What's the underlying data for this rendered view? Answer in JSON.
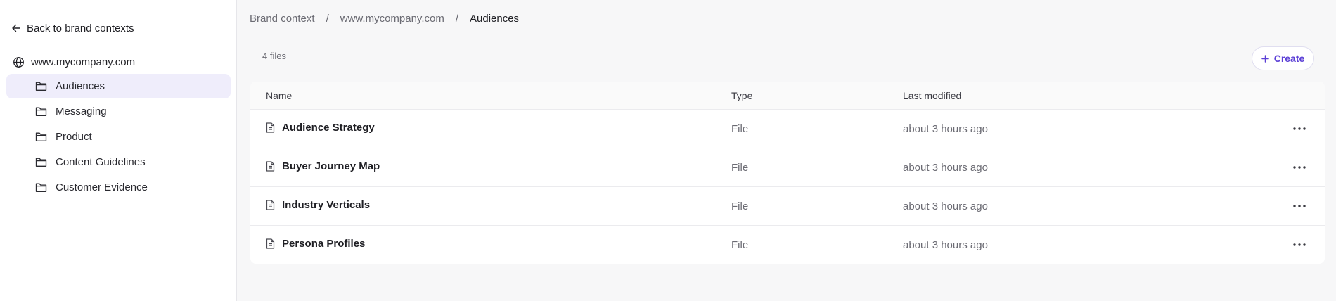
{
  "sidebar": {
    "back_label": "Back to brand contexts",
    "site": "www.mycompany.com",
    "folders": [
      {
        "label": "Audiences",
        "active": true
      },
      {
        "label": "Messaging",
        "active": false
      },
      {
        "label": "Product",
        "active": false
      },
      {
        "label": "Content Guidelines",
        "active": false
      },
      {
        "label": "Customer Evidence",
        "active": false
      }
    ]
  },
  "breadcrumb": {
    "items": [
      "Brand context",
      "www.mycompany.com",
      "Audiences"
    ],
    "separator": "/"
  },
  "toolbar": {
    "file_count": "4 files",
    "create_label": "Create"
  },
  "table": {
    "columns": [
      "Name",
      "Type",
      "Last modified"
    ],
    "rows": [
      {
        "name": "Audience Strategy",
        "type": "File",
        "modified": "about 3 hours ago"
      },
      {
        "name": "Buyer Journey Map",
        "type": "File",
        "modified": "about 3 hours ago"
      },
      {
        "name": "Industry Verticals",
        "type": "File",
        "modified": "about 3 hours ago"
      },
      {
        "name": "Persona Profiles",
        "type": "File",
        "modified": "about 3 hours ago"
      }
    ]
  },
  "colors": {
    "accent": "#5b3fd6",
    "active_bg": "#efedfb",
    "page_bg": "#f7f7f8"
  },
  "icons": {
    "back": "arrow-left-icon",
    "site": "globe-icon",
    "folder": "folder-icon",
    "file": "file-text-icon",
    "create": "plus-icon",
    "more": "more-horizontal-icon"
  }
}
